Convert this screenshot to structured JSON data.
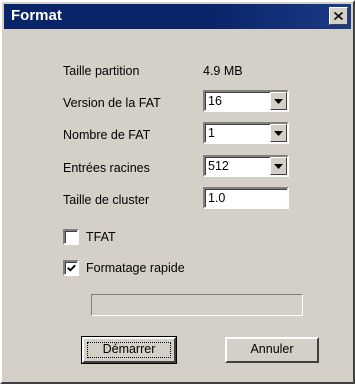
{
  "window": {
    "title": "Format"
  },
  "fields": {
    "partition_size": {
      "label": "Taille partition",
      "value": "4.9 MB"
    },
    "fat_version": {
      "label": "Version de la FAT",
      "value": "16"
    },
    "fat_count": {
      "label": "Nombre de FAT",
      "value": "1"
    },
    "root_entries": {
      "label": "Entrées racines",
      "value": "512"
    },
    "cluster_size": {
      "label": "Taille de cluster",
      "value": "1.0"
    }
  },
  "options": {
    "tfat": {
      "label": "TFAT",
      "checked": false
    },
    "quick_format": {
      "label": "Formatage rapide",
      "checked": true
    }
  },
  "progress": {
    "value": 0
  },
  "buttons": {
    "start": "Démarrer",
    "cancel": "Annuler"
  },
  "icons": {
    "close": "close-icon",
    "dropdown": "chevron-down-icon",
    "check": "checkmark-icon"
  }
}
